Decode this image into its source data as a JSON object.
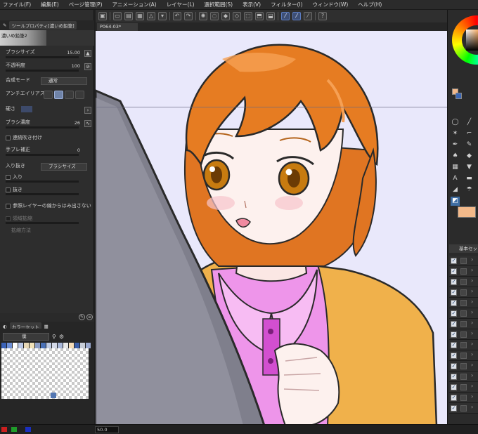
{
  "menu": [
    "ファイル(F)",
    "編集(E)",
    "ページ管理(P)",
    "アニメーション(A)",
    "レイヤー(L)",
    "選択範囲(S)",
    "表示(V)",
    "フィルター(I)",
    "ウィンドウ(W)",
    "ヘルプ(H)"
  ],
  "left_panel": {
    "tool_property_tab": "ツールプロパティ[濃いめ鉛筆]",
    "tool_name": "濃いめ鉛筆2",
    "properties": {
      "brush_size_label": "ブラシサイズ",
      "brush_size_value": "15.00",
      "opacity_label": "不透明度",
      "opacity_value": "100",
      "blend_mode_label": "合成モード",
      "blend_mode_value": "通常",
      "antialias_label": "アンチエイリアス",
      "hardness_label": "硬さ",
      "brush_density_label": "ブラシ濃度",
      "brush_density_value": "26",
      "continuous_spray_label": "連続吹き付け",
      "stabilization_label": "手ブレ補正",
      "stabilization_value": "0",
      "taper_label": "入り抜き",
      "taper_value": "ブラシサイズ",
      "taper_in_label": "入り",
      "taper_out_label": "抜き",
      "ref_layer_label": "参照レイヤーの線からはみ出さない",
      "expand_label": "領域拡縮",
      "expand_method_label": "拡縮方法"
    },
    "colorset_tab": "カラーセット",
    "colorset_name": "僕"
  },
  "canvas": {
    "doc_tab": "P064-03*",
    "zoom": "50.0"
  },
  "right_panel": {
    "layer_set_tab": "基本セット"
  },
  "colors": {
    "accent": "#3d4f76",
    "sub_color": "#f3b98a",
    "canvas_bg": "#e9e8fb"
  }
}
